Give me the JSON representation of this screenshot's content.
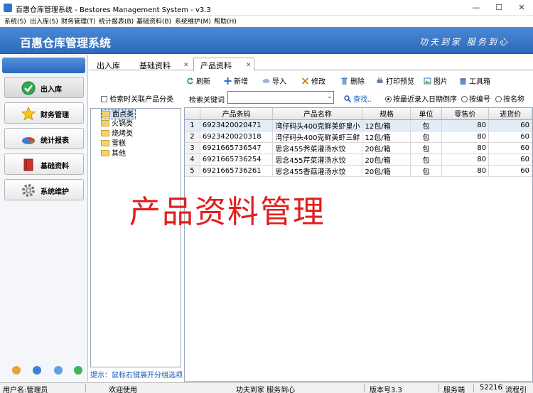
{
  "window": {
    "title": "百惠仓库管理系统 - Bestores Management System - v3.3"
  },
  "menu": [
    "系统(S)",
    "出入库(S)",
    "财务管理(T)",
    "统计报表(B)",
    "基础资料(B)",
    "系统维护(M)",
    "帮助(H)"
  ],
  "banner": {
    "title": "百惠仓库管理系统",
    "slogan": "功夫到家 服务到心"
  },
  "nav": [
    {
      "label": "出入库",
      "icon": "green-check-icon"
    },
    {
      "label": "财务管理",
      "icon": "star-icon"
    },
    {
      "label": "统计报表",
      "icon": "pie-chart-icon"
    },
    {
      "label": "基础资料",
      "icon": "red-book-icon"
    },
    {
      "label": "系统维护",
      "icon": "gear-icon"
    }
  ],
  "tabs": [
    {
      "label": "出入库"
    },
    {
      "label": "基础资料"
    },
    {
      "label": "产品资料",
      "active": true
    }
  ],
  "toolbar": [
    "刷新",
    "新增",
    "导入",
    "修改",
    "删除",
    "打印预览",
    "图片",
    "工具箱"
  ],
  "category_panel": {
    "checkbox_label": "检索时关联产品分类",
    "items": [
      "面点类",
      "火锅类",
      "烧烤类",
      "雪糕",
      "其他"
    ],
    "hint": "提示：鼠标右键展开分组选项"
  },
  "search": {
    "label": "检索关键词",
    "value": "",
    "button": "查找..",
    "options": [
      "按最近录入日期倒序",
      "按编号",
      "按名称"
    ],
    "selected": 0
  },
  "grid": {
    "columns": [
      "产品条码",
      "产品名称",
      "规格",
      "单位",
      "零售价",
      "进货价"
    ],
    "rows": [
      {
        "n": "1",
        "barcode": "6923420020471",
        "name": "湾仔码头400克鲜美虾皇小",
        "spec": "12包/箱",
        "unit": "包",
        "retail": "80",
        "cost": "60"
      },
      {
        "n": "2",
        "barcode": "6923420020318",
        "name": "湾仔码头400克鲜美虾三鲜",
        "spec": "12包/箱",
        "unit": "包",
        "retail": "80",
        "cost": "60"
      },
      {
        "n": "3",
        "barcode": "6921665736547",
        "name": "思念455荠菜灌汤水饺",
        "spec": "20包/箱",
        "unit": "包",
        "retail": "80",
        "cost": "60"
      },
      {
        "n": "4",
        "barcode": "6921665736254",
        "name": "思念455芹菜灌汤水饺",
        "spec": "20包/箱",
        "unit": "包",
        "retail": "80",
        "cost": "60"
      },
      {
        "n": "5",
        "barcode": "6921665736261",
        "name": "思念455香菇灌汤水饺",
        "spec": "20包/箱",
        "unit": "包",
        "retail": "80",
        "cost": "60"
      }
    ]
  },
  "watermark": "产品资料管理",
  "status": {
    "user": "用户名:管理员",
    "welcome": "欢迎使用",
    "slogan": "功夫到家 服务到心",
    "version": "版本号3.3",
    "server": "服务端",
    "port": "52216",
    "flow": "流程引"
  },
  "colors": {
    "banner": "#2c69ba",
    "watermark": "#e21d1d",
    "hint": "#1556b8"
  }
}
